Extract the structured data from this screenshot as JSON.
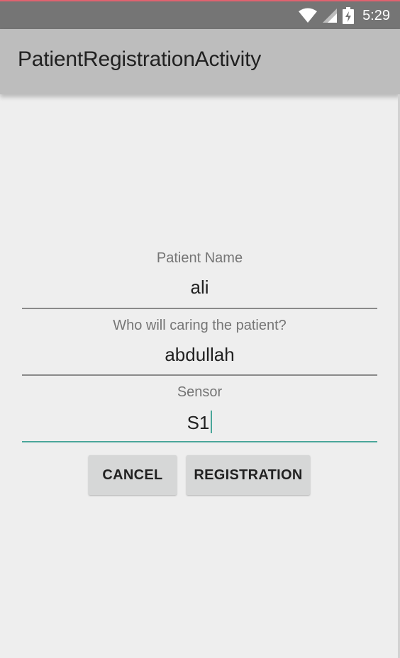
{
  "status_bar": {
    "time": "5:29",
    "icons": [
      "wifi-icon",
      "cell-signal-icon",
      "battery-charging-icon"
    ]
  },
  "app_bar": {
    "title": "PatientRegistrationActivity"
  },
  "form": {
    "patient_name": {
      "label": "Patient Name",
      "value": "ali"
    },
    "caregiver": {
      "label": "Who will caring the patient?",
      "value": "abdullah"
    },
    "sensor": {
      "label": "Sensor",
      "value": "S1"
    }
  },
  "buttons": {
    "cancel": "CANCEL",
    "registration": "REGISTRATION"
  },
  "colors": {
    "accent": "#4aa69a",
    "status_bar": "#757575",
    "app_bar": "#bdbdbd",
    "background": "#eeeeee",
    "button": "#d6d7d7"
  }
}
